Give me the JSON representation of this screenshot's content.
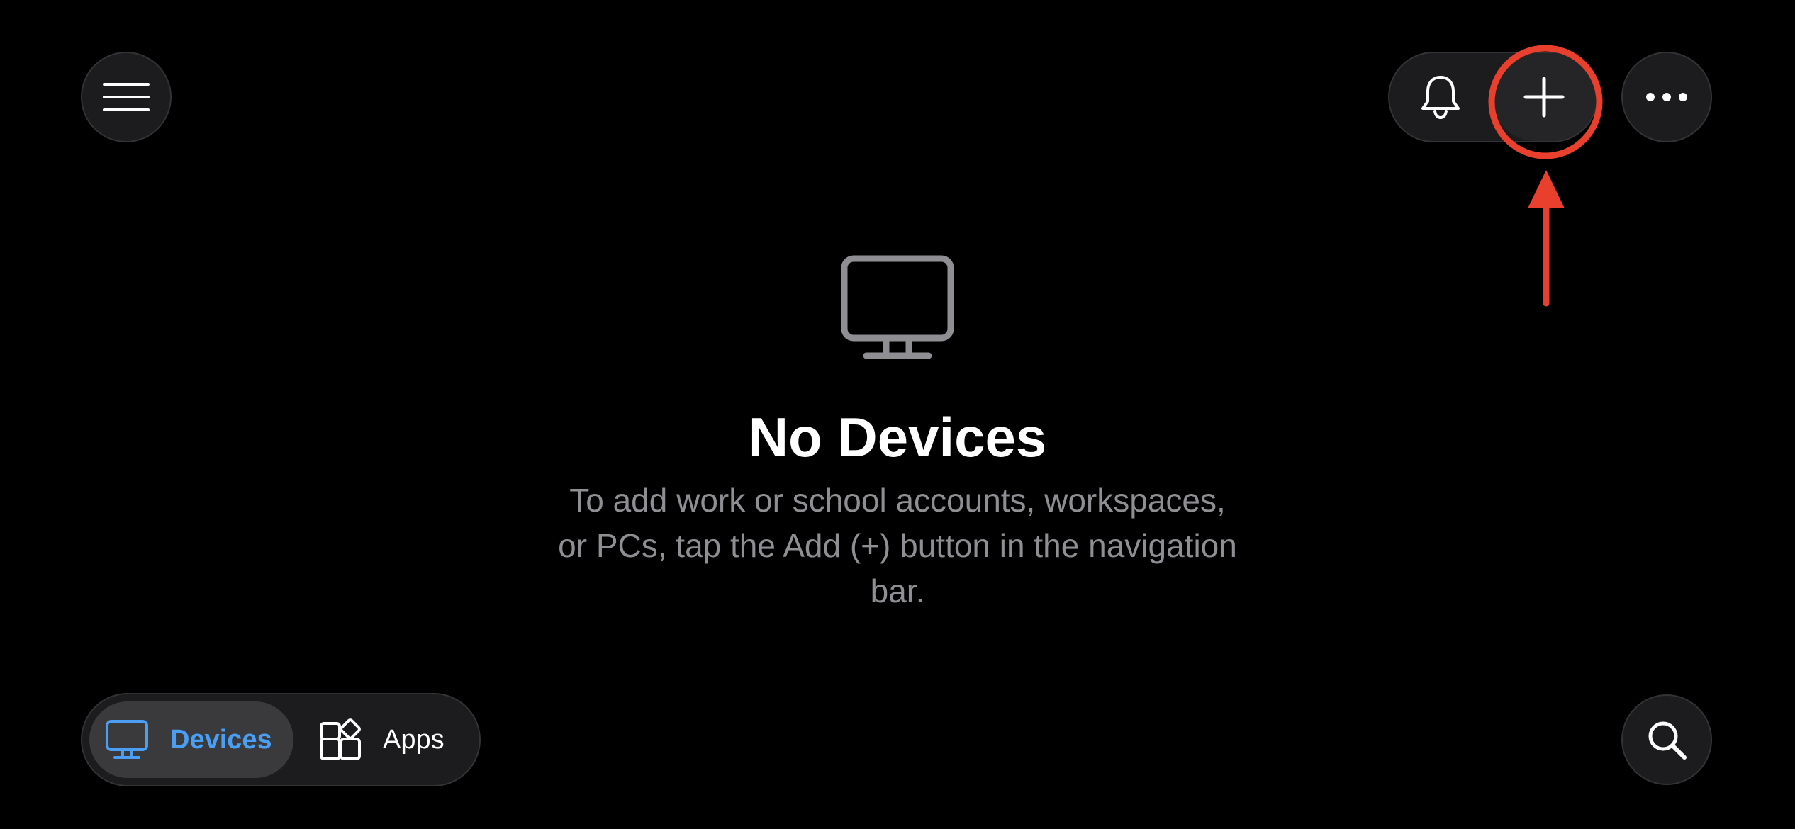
{
  "toolbar": {
    "menu_icon": "hamburger-menu-icon",
    "notifications_icon": "bell-icon",
    "add_icon": "plus-icon",
    "more_icon": "ellipsis-icon"
  },
  "empty_state": {
    "icon": "monitor-icon",
    "title": "No Devices",
    "description": "To add work or school accounts, workspaces, or PCs, tap the Add (+) button in the navigation bar."
  },
  "tabs": [
    {
      "label": "Devices",
      "icon": "monitor-icon",
      "selected": true
    },
    {
      "label": "Apps",
      "icon": "apps-icon",
      "selected": false
    }
  ],
  "search": {
    "icon": "search-icon"
  },
  "colors": {
    "background": "#000000",
    "accent": "#4a9ff5",
    "annotation": "#e8402c",
    "muted_text": "#8e8e93"
  }
}
